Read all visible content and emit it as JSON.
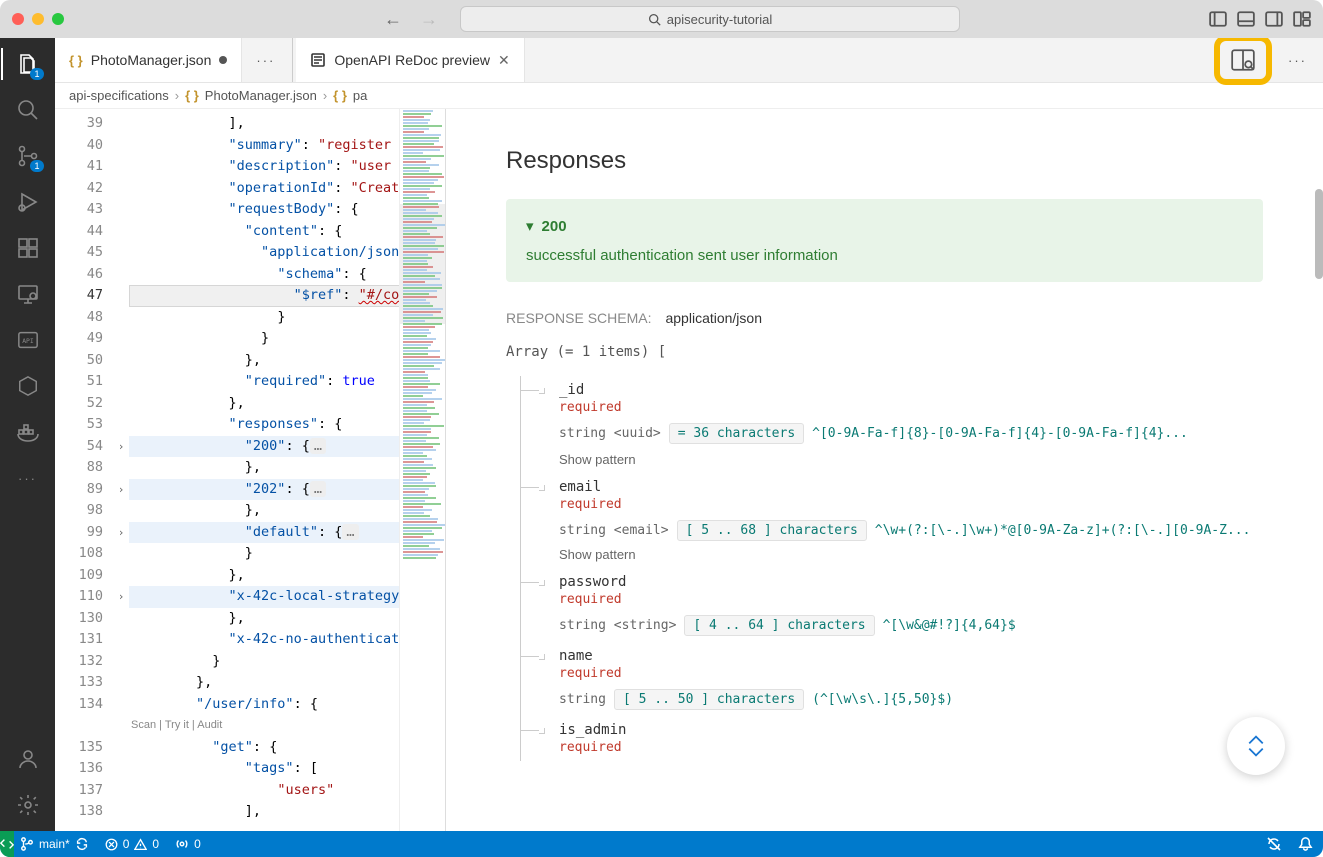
{
  "title": "apisecurity-tutorial",
  "tabs": [
    {
      "label": "PhotoManager.json",
      "dirty": true
    },
    {
      "label": "OpenAPI ReDoc preview",
      "closable": true
    }
  ],
  "breadcrumb": {
    "folder": "api-specifications",
    "file": "PhotoManager.json",
    "symbol": "pa"
  },
  "editor": {
    "lines": [
      {
        "n": 39,
        "indent": 6,
        "tokens": [
          {
            "t": "],",
            "c": "p"
          }
        ]
      },
      {
        "n": 40,
        "indent": 6,
        "tokens": [
          {
            "t": "\"summary\"",
            "c": "k"
          },
          {
            "t": ": ",
            "c": "p"
          },
          {
            "t": "\"register",
            "c": "s"
          }
        ]
      },
      {
        "n": 41,
        "indent": 6,
        "tokens": [
          {
            "t": "\"description\"",
            "c": "k"
          },
          {
            "t": ": ",
            "c": "p"
          },
          {
            "t": "\"user",
            "c": "s"
          }
        ]
      },
      {
        "n": 42,
        "indent": 6,
        "tokens": [
          {
            "t": "\"operationId\"",
            "c": "k"
          },
          {
            "t": ": ",
            "c": "p"
          },
          {
            "t": "\"Creat",
            "c": "s"
          }
        ]
      },
      {
        "n": 43,
        "indent": 6,
        "tokens": [
          {
            "t": "\"requestBody\"",
            "c": "k"
          },
          {
            "t": ": ",
            "c": "p"
          },
          {
            "t": "{",
            "c": "p"
          }
        ]
      },
      {
        "n": 44,
        "indent": 7,
        "tokens": [
          {
            "t": "\"content\"",
            "c": "k"
          },
          {
            "t": ": ",
            "c": "p"
          },
          {
            "t": "{",
            "c": "p"
          }
        ]
      },
      {
        "n": 45,
        "indent": 8,
        "tokens": [
          {
            "t": "\"application/json",
            "c": "k"
          }
        ]
      },
      {
        "n": 46,
        "indent": 9,
        "tokens": [
          {
            "t": "\"schema\"",
            "c": "k"
          },
          {
            "t": ": ",
            "c": "p"
          },
          {
            "t": "{",
            "c": "p"
          }
        ]
      },
      {
        "n": 47,
        "indent": 10,
        "active": true,
        "tokens": [
          {
            "t": "\"$ref\"",
            "c": "k"
          },
          {
            "t": ": ",
            "c": "p"
          },
          {
            "t": "\"#/co",
            "c": "ref"
          }
        ]
      },
      {
        "n": 48,
        "indent": 9,
        "tokens": [
          {
            "t": "}",
            "c": "p"
          }
        ]
      },
      {
        "n": 49,
        "indent": 8,
        "tokens": [
          {
            "t": "}",
            "c": "p"
          }
        ]
      },
      {
        "n": 50,
        "indent": 7,
        "tokens": [
          {
            "t": "},",
            "c": "p"
          }
        ]
      },
      {
        "n": 51,
        "indent": 7,
        "tokens": [
          {
            "t": "\"required\"",
            "c": "k"
          },
          {
            "t": ": ",
            "c": "p"
          },
          {
            "t": "true",
            "c": "b"
          }
        ]
      },
      {
        "n": 52,
        "indent": 6,
        "tokens": [
          {
            "t": "},",
            "c": "p"
          }
        ]
      },
      {
        "n": 53,
        "indent": 6,
        "tokens": [
          {
            "t": "\"responses\"",
            "c": "k"
          },
          {
            "t": ": ",
            "c": "p"
          },
          {
            "t": "{",
            "c": "p"
          }
        ]
      },
      {
        "n": 54,
        "indent": 7,
        "fold": true,
        "collapsed": true,
        "tokens": [
          {
            "t": "\"200\"",
            "c": "k"
          },
          {
            "t": ": ",
            "c": "p"
          },
          {
            "t": "{",
            "c": "p"
          },
          {
            "t": "…",
            "c": "pill"
          }
        ]
      },
      {
        "n": 88,
        "indent": 7,
        "tokens": [
          {
            "t": "},",
            "c": "p"
          }
        ]
      },
      {
        "n": 89,
        "indent": 7,
        "fold": true,
        "collapsed": true,
        "tokens": [
          {
            "t": "\"202\"",
            "c": "k"
          },
          {
            "t": ": ",
            "c": "p"
          },
          {
            "t": "{",
            "c": "p"
          },
          {
            "t": "…",
            "c": "pill"
          }
        ]
      },
      {
        "n": 98,
        "indent": 7,
        "tokens": [
          {
            "t": "},",
            "c": "p"
          }
        ]
      },
      {
        "n": 99,
        "indent": 7,
        "fold": true,
        "collapsed": true,
        "tokens": [
          {
            "t": "\"default\"",
            "c": "k"
          },
          {
            "t": ": ",
            "c": "p"
          },
          {
            "t": "{",
            "c": "p"
          },
          {
            "t": "…",
            "c": "pill"
          }
        ]
      },
      {
        "n": 108,
        "indent": 7,
        "tokens": [
          {
            "t": "}",
            "c": "p"
          }
        ]
      },
      {
        "n": 109,
        "indent": 6,
        "tokens": [
          {
            "t": "},",
            "c": "p"
          }
        ]
      },
      {
        "n": 110,
        "indent": 6,
        "fold": true,
        "collapsed": true,
        "tokens": [
          {
            "t": "\"x-42c-local-strategy",
            "c": "k"
          }
        ]
      },
      {
        "n": 130,
        "indent": 6,
        "tokens": [
          {
            "t": "},",
            "c": "p"
          }
        ]
      },
      {
        "n": 131,
        "indent": 6,
        "tokens": [
          {
            "t": "\"x-42c-no-authenticat",
            "c": "k"
          }
        ]
      },
      {
        "n": 132,
        "indent": 5,
        "tokens": [
          {
            "t": "}",
            "c": "p"
          }
        ]
      },
      {
        "n": 133,
        "indent": 4,
        "tokens": [
          {
            "t": "},",
            "c": "p"
          }
        ]
      },
      {
        "n": 134,
        "indent": 4,
        "tokens": [
          {
            "t": "\"/user/info\"",
            "c": "k"
          },
          {
            "t": ": ",
            "c": "p"
          },
          {
            "t": "{",
            "c": "p"
          }
        ]
      },
      {
        "n": 135,
        "indent": 5,
        "lens": "Scan | Try it | Audit",
        "tokens": [
          {
            "t": "\"get\"",
            "c": "k"
          },
          {
            "t": ": ",
            "c": "p"
          },
          {
            "t": "{",
            "c": "p"
          }
        ]
      },
      {
        "n": 136,
        "indent": 7,
        "tokens": [
          {
            "t": "\"tags\"",
            "c": "k"
          },
          {
            "t": ": ",
            "c": "p"
          },
          {
            "t": "[",
            "c": "p"
          }
        ]
      },
      {
        "n": 137,
        "indent": 9,
        "tokens": [
          {
            "t": "\"users\"",
            "c": "s"
          }
        ]
      },
      {
        "n": 138,
        "indent": 7,
        "tokens": [
          {
            "t": "],",
            "c": "p"
          }
        ]
      }
    ]
  },
  "preview": {
    "heading": "Responses",
    "status_code": "200",
    "status_desc": "successful authentication sent user information",
    "schema_label": "RESPONSE SCHEMA:",
    "content_type": "application/json",
    "array_line": "Array (= 1 items) [",
    "show_pattern": "Show pattern",
    "fields": [
      {
        "name": "_id",
        "required": true,
        "type": "string <uuid>",
        "constraint": "= 36 characters",
        "pattern": "^[0-9A-Fa-f]{8}-[0-9A-Fa-f]{4}-[0-9A-Fa-f]{4}...",
        "show_pattern": true
      },
      {
        "name": "email",
        "required": true,
        "type": "string <email>",
        "constraint": "[ 5 .. 68 ] characters",
        "pattern": "^\\w+(?:[\\-.]\\w+)*@[0-9A-Za-z]+(?:[\\-.][0-9A-Z...",
        "show_pattern": true,
        "pattern_below": true
      },
      {
        "name": "password",
        "required": true,
        "type": "string <string>",
        "constraint": "[ 4 .. 64 ] characters",
        "pattern": "^[\\w&@#!?]{4,64}$"
      },
      {
        "name": "name",
        "required": true,
        "type": "string",
        "constraint": "[ 5 .. 50 ] characters",
        "pattern": "(^[\\w\\s\\.]{5,50}$)"
      },
      {
        "name": "is_admin",
        "required": true
      }
    ]
  },
  "status": {
    "remote": "remote",
    "branch": "main*",
    "errors": "0",
    "warnings": "0",
    "port": "0"
  },
  "activity_badge": "1",
  "scm_badge": "1",
  "required_label": "required",
  "chevron_down_glyph": "▾"
}
